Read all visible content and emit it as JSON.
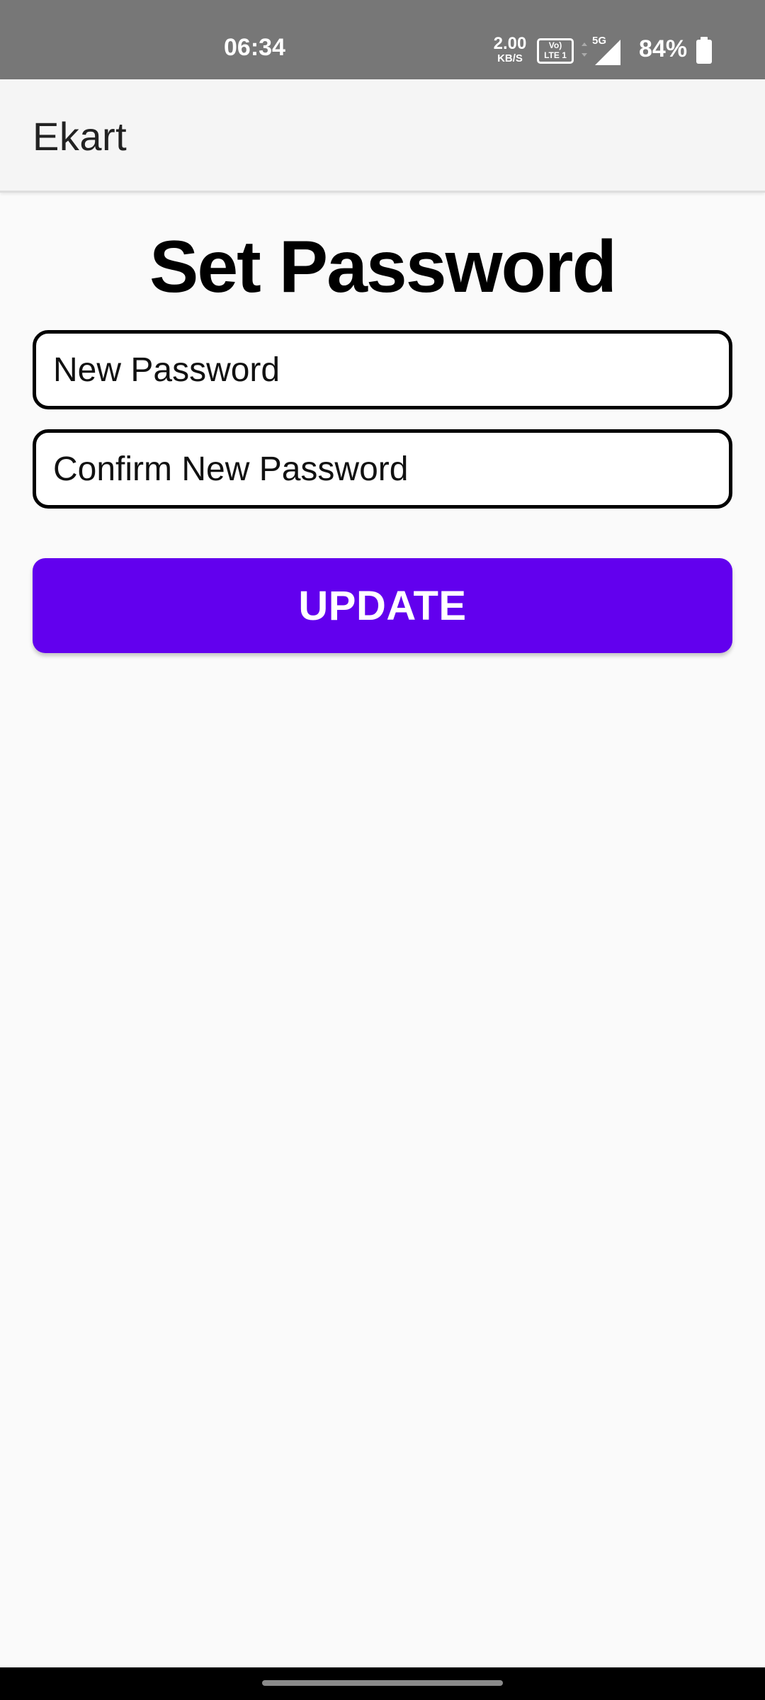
{
  "status_bar": {
    "time": "06:34",
    "net_speed_value": "2.00",
    "net_speed_unit": "KB/S",
    "volte_top": "Vo)",
    "volte_bottom": "LTE 1",
    "network_type": "5G",
    "battery": "84%",
    "icons": [
      "signal-icon",
      "battery-icon"
    ]
  },
  "app_bar": {
    "title": "Ekart"
  },
  "main": {
    "title": "Set Password",
    "new_password": {
      "value": "",
      "placeholder": "New Password"
    },
    "confirm_password": {
      "value": "",
      "placeholder": "Confirm New Password"
    },
    "update_label": "UPDATE"
  },
  "colors": {
    "status_bar": "#777777",
    "app_bar": "#f5f5f5",
    "background": "#fafafa",
    "accent": "#6200ee",
    "text": "#000000"
  }
}
